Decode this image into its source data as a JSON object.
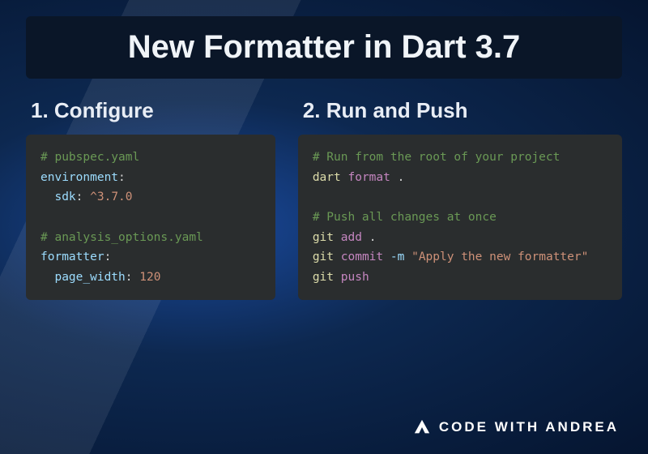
{
  "title": "New Formatter in Dart 3.7",
  "sections": {
    "left": {
      "heading": "1.  Configure",
      "code": {
        "comment1": "# pubspec.yaml",
        "env_key": "environment",
        "sdk_key": "sdk",
        "sdk_val": "^3.7.0",
        "comment2": "# analysis_options.yaml",
        "fmt_key": "formatter",
        "pw_key": "page_width",
        "pw_val": "120"
      }
    },
    "right": {
      "heading": "2.  Run and Push",
      "code": {
        "comment1": "# Run from the root of your project",
        "cmd1_a": "dart",
        "cmd1_b": "format",
        "cmd1_c": ".",
        "comment2": "# Push all changes at once",
        "cmd2_a": "git",
        "cmd2_b": "add",
        "cmd2_c": ".",
        "cmd3_a": "git",
        "cmd3_b": "commit",
        "cmd3_flag": "-m",
        "cmd3_msg": "\"Apply the new formatter\"",
        "cmd4_a": "git",
        "cmd4_b": "push"
      }
    }
  },
  "branding": {
    "text": "CODE WITH ANDREA"
  }
}
